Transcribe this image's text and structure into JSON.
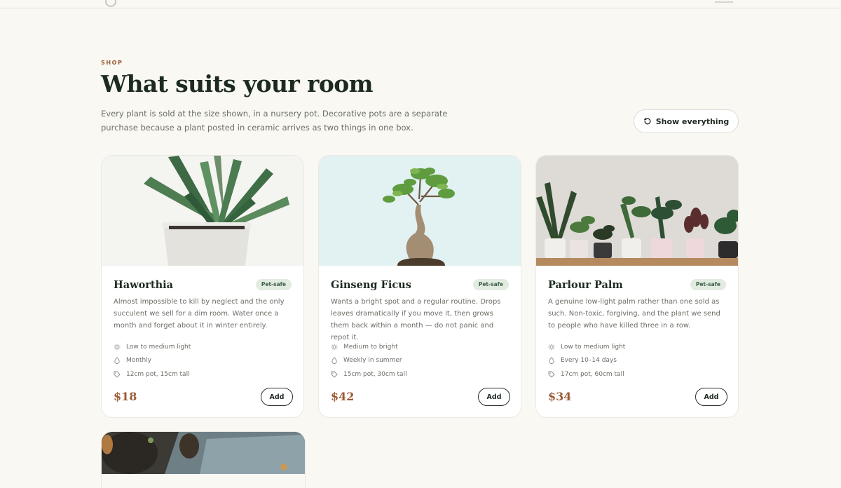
{
  "section": {
    "eyebrow": "SHOP",
    "title": "What suits your room",
    "lede": "Every plant is sold at the size shown, in a nursery pot. Decorative pots are a separate purchase because a plant posted in ceramic arrives as two things in one box.",
    "show_button": {
      "label": "Show everything",
      "icon": "refresh-icon"
    }
  },
  "products": [
    {
      "name": "Haworthia",
      "badge": "Pet-safe",
      "description": "Almost impossible to kill by neglect and the only succulent we sell for a dim room. Water once a month and forget about it in winter entirely.",
      "light": "Low to medium light",
      "water": "Monthly",
      "size": "12cm pot, 15cm tall",
      "price": "$18",
      "add_label": "Add"
    },
    {
      "name": "Ginseng Ficus",
      "badge": "Pet-safe",
      "description": "Wants a bright spot and a regular routine. Drops leaves dramatically if you move it, then grows them back within a month — do not panic and repot it.",
      "light": "Medium to bright",
      "water": "Weekly in summer",
      "size": "15cm pot, 30cm tall",
      "price": "$42",
      "add_label": "Add"
    },
    {
      "name": "Parlour Palm",
      "badge": "Pet-safe",
      "description": "A genuine low-light palm rather than one sold as such. Non-toxic, forgiving, and the plant we send to people who have killed three in a row.",
      "light": "Low to medium light",
      "water": "Every 10–14 days",
      "size": "17cm pot, 60cm tall",
      "price": "$34",
      "add_label": "Add"
    }
  ],
  "icons": {
    "light": "sun-icon",
    "water": "droplet-icon",
    "size": "tag-icon"
  },
  "colors": {
    "accent": "#9a5b34",
    "badge_bg": "#e1ebe0",
    "background": "#f9f8f3"
  }
}
